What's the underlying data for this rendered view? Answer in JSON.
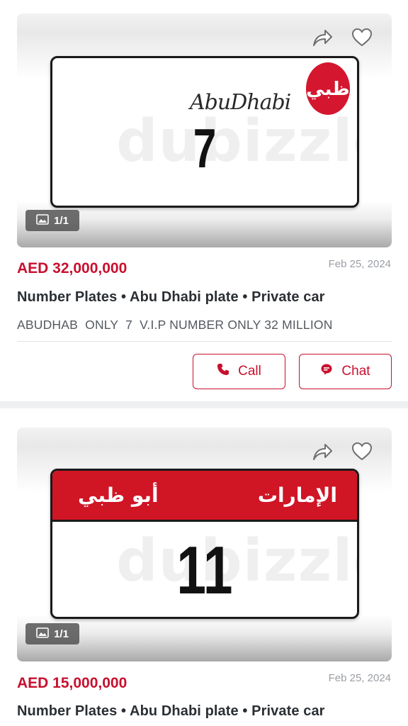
{
  "listings": [
    {
      "plate": {
        "city_en": "AbuDhabi",
        "emblem_text": "ظبي",
        "watermark": "dubizzle",
        "number": "7"
      },
      "counter": "1/1",
      "price": "AED 32,000,000",
      "date": "Feb 25, 2024",
      "category": "Number Plates • Abu Dhabi plate • Private car",
      "description": "ABUDHAB  ONLY  7  V.I.P NUMBER ONLY 32 MILLION",
      "actions": {
        "call_label": "Call",
        "chat_label": "Chat"
      }
    },
    {
      "plate": {
        "header_left": "أبو ظبي",
        "header_right": "الإمارات",
        "watermark": "dubizzle",
        "number": "11"
      },
      "counter": "1/1",
      "price": "AED 15,000,000",
      "date": "Feb 25, 2024",
      "category": "Number Plates • Abu Dhabi plate • Private car"
    }
  ],
  "icons": {
    "share": "share-icon",
    "favorite": "heart-icon",
    "gallery": "image-icon",
    "call": "phone-icon",
    "chat": "chat-icon"
  },
  "colors": {
    "accent": "#c8102e",
    "plate_red": "#d01525",
    "muted": "#9a9ea4"
  }
}
